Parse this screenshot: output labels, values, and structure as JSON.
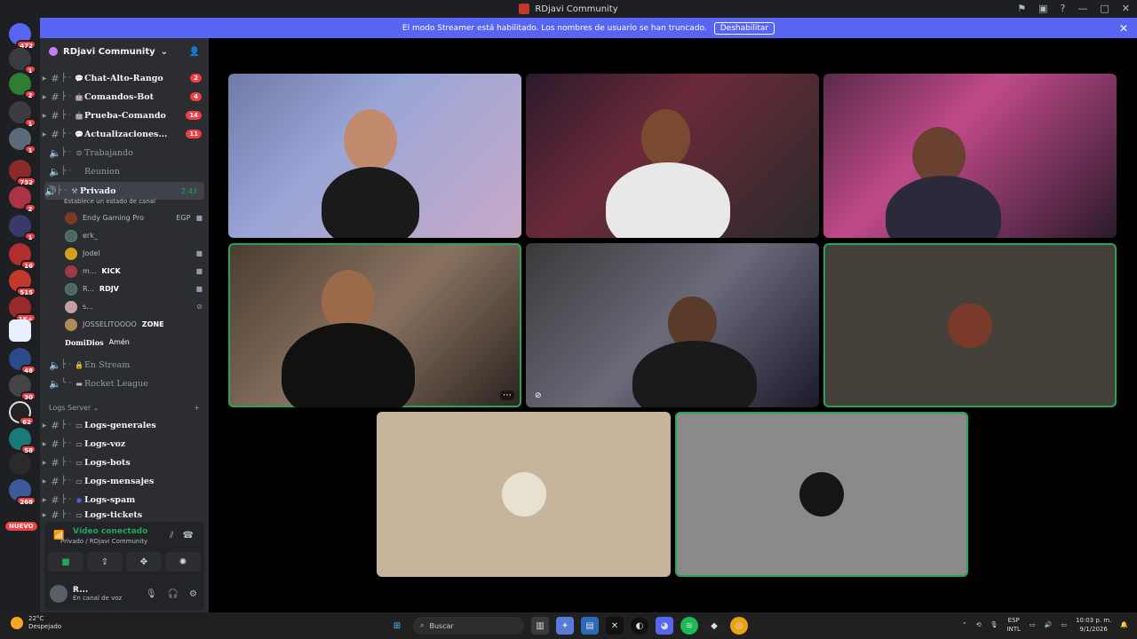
{
  "window": {
    "title": "RDjavi Community",
    "controls": [
      "flag-icon",
      "monitor-icon",
      "help-icon",
      "—",
      "□",
      "✕"
    ]
  },
  "banner": {
    "text": "El modo Streamer está habilitado. Los nombres de usuario se han truncado.",
    "button": "Deshabilitar"
  },
  "guilds": {
    "badges": [
      "472",
      "1",
      "2",
      "1",
      "1",
      "732",
      "2",
      "1",
      "16",
      "515",
      "1K+",
      "48",
      "30",
      "62",
      "58",
      "268"
    ],
    "nuevo": "NUEVO"
  },
  "server": {
    "name": "RDjavi Community",
    "chevron": "⌄"
  },
  "channels": [
    {
      "name": "Chat-Alto-Rango",
      "badge": "2",
      "emoji": "💬"
    },
    {
      "name": "Comandos-Bot",
      "badge": "4",
      "emoji": "🤖"
    },
    {
      "name": "Prueba-Comando",
      "badge": "14",
      "emoji": "🤖"
    },
    {
      "name": "Actualizaciones...",
      "badge": "11",
      "emoji": "💬"
    }
  ],
  "voice_channels": [
    {
      "name": "Trabajando",
      "emoji": "⊙"
    },
    {
      "name": "Reunion",
      "emoji": ""
    }
  ],
  "active_channel": {
    "name": "Privado",
    "timer": "2:43",
    "status": "Establece un estado de canal"
  },
  "members": [
    {
      "name": "Endy Gaming Pro",
      "tag": "EGP"
    },
    {
      "name": "erk_",
      "tag": ""
    },
    {
      "name": "Jodel",
      "tag": ""
    },
    {
      "name": "m...",
      "tag": "KICK"
    },
    {
      "name": "R...",
      "tag": "RDJV"
    },
    {
      "name": "s...",
      "tag": ""
    },
    {
      "name": "JOSSELITOOOO",
      "tag": "ZONE"
    },
    {
      "name": "DomiDios",
      "tag": "Amén"
    }
  ],
  "locked_channels": [
    {
      "name": "En Stream"
    },
    {
      "name": "Rocket League"
    }
  ],
  "logs_category": {
    "name": "Logs Server",
    "plus": "+"
  },
  "log_channels": [
    {
      "name": "Logs-generales"
    },
    {
      "name": "Logs-voz"
    },
    {
      "name": "Logs-bots"
    },
    {
      "name": "Logs-mensajes"
    },
    {
      "name": "Logs-spam"
    },
    {
      "name": "Logs-tickets"
    }
  ],
  "voice_status": {
    "title": "Vídeo conectado",
    "sub": "Privado / RDjavi Community"
  },
  "user": {
    "name": "R...",
    "status": "En canal de voz"
  },
  "taskbar": {
    "weather_temp": "22°C",
    "weather_desc": "Despejado",
    "search": "Buscar",
    "lang1": "ESP",
    "lang2": "INTL",
    "time": "10:03 p. m.",
    "date": "9/1/2026"
  },
  "colors": {
    "accent": "#5865f2",
    "speaking": "#23a55a",
    "badge": "#f23f43"
  }
}
